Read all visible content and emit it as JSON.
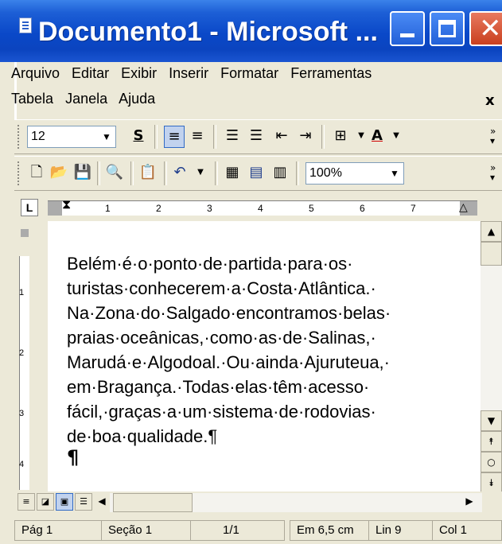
{
  "window": {
    "title": "Documento1 - Microsoft ...",
    "close_glyph": "✕"
  },
  "menu": {
    "row1": [
      "Arquivo",
      "Editar",
      "Exibir",
      "Inserir",
      "Formatar",
      "Ferramentas"
    ],
    "row2": [
      "Tabela",
      "Janela",
      "Ajuda"
    ],
    "mdi_close": "x"
  },
  "format_toolbar": {
    "font_size": "12",
    "underline_label": "S",
    "font_color_label": "A",
    "icons": [
      "align-left-icon",
      "align-center-icon",
      "numbered-list-icon",
      "bullet-list-icon",
      "decrease-indent-icon",
      "increase-indent-icon",
      "border-icon",
      "font-color-icon"
    ]
  },
  "standard_toolbar": {
    "zoom": "100%",
    "icons": [
      "new-document-icon",
      "open-icon",
      "save-icon",
      "print-preview-icon",
      "paste-icon",
      "undo-icon",
      "table-insert-icon",
      "excel-insert-icon",
      "columns-icon"
    ]
  },
  "ruler": {
    "tab_selector": "L",
    "numbers": [
      "1",
      "2",
      "3",
      "4",
      "5",
      "6",
      "7"
    ]
  },
  "document": {
    "lines": [
      "Belém·é·o·ponto·de·partida·para·os·",
      "turistas·conhecerem·a·Costa·Atlântica.·",
      "Na·Zona·do·Salgado·encontramos·belas·",
      "praias·oceânicas,·como·as·de·Salinas,·",
      "Marudá·e·Algodoal.·Ou·ainda·Ajuruteua,·",
      "em·Bragança.·Todas·elas·têm·acesso·",
      "fácil,·graças·a·um·sistema·de·rodovias·",
      "de·boa·qualidade.¶"
    ],
    "cursor_line": "¶"
  },
  "vruler": {
    "numbers": [
      "1",
      "2",
      "3",
      "4"
    ]
  },
  "status": {
    "page": "Pág 1",
    "section": "Seção 1",
    "pages": "1/1",
    "position": "Em 6,5 cm",
    "line": "Lin 9",
    "column": "Col 1"
  }
}
